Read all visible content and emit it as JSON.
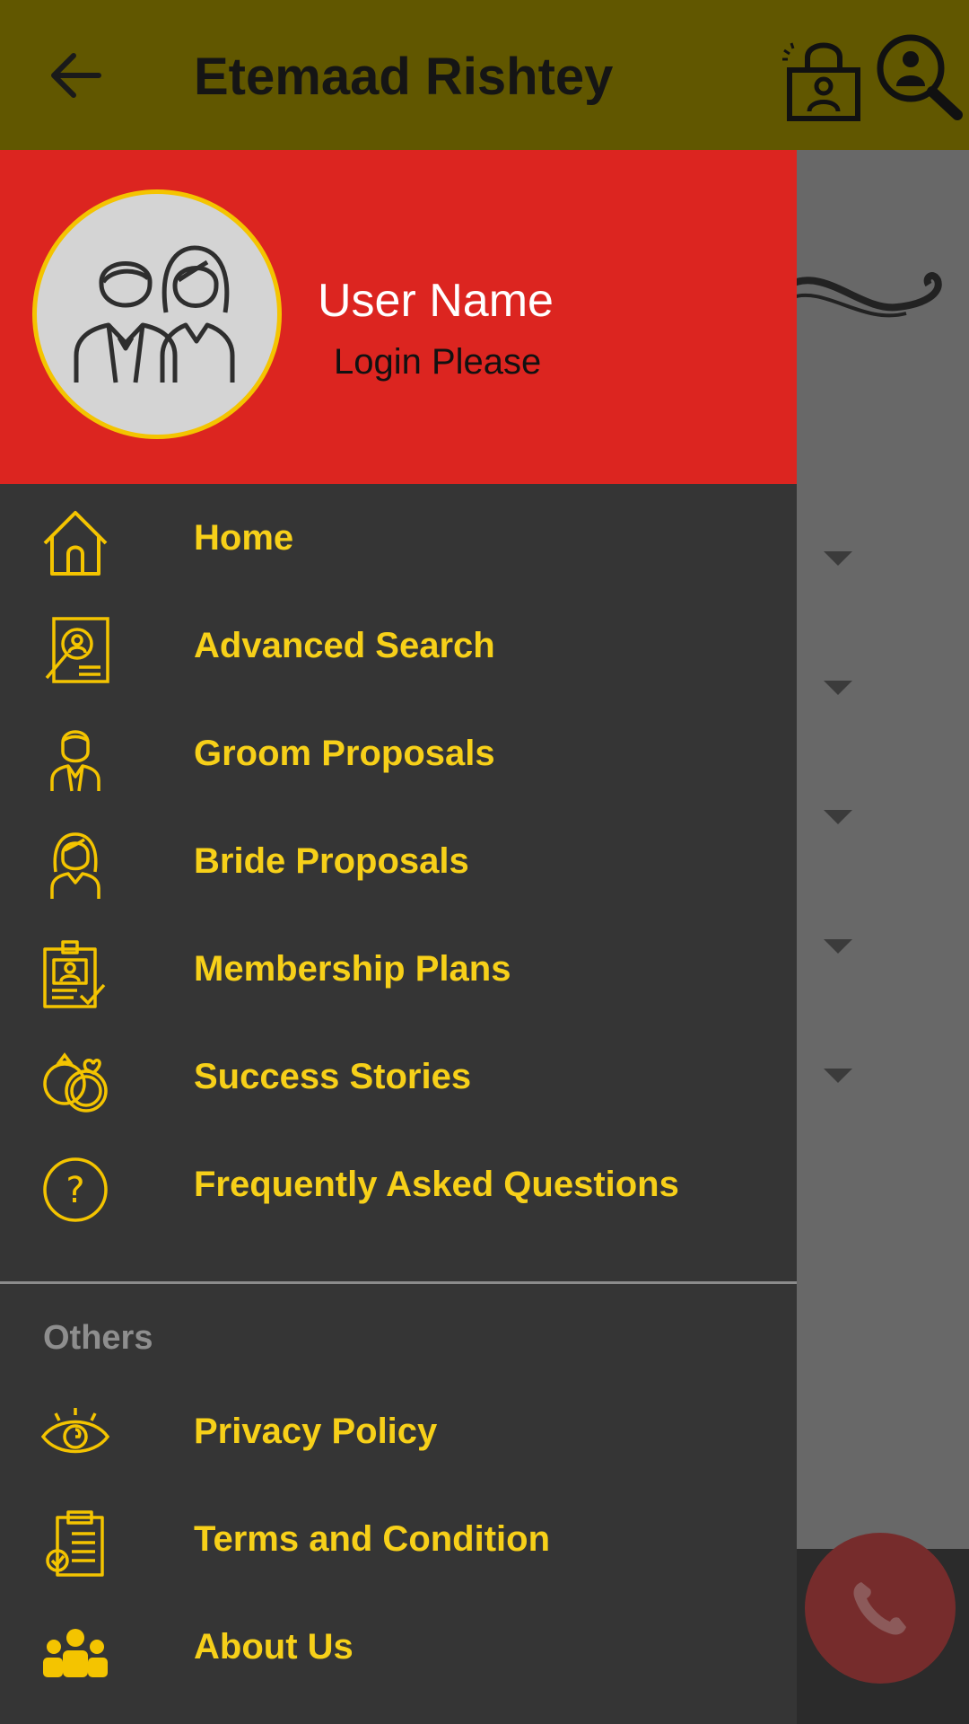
{
  "toolbar": {
    "title": "Etemaad Rishtey",
    "back_icon": "arrow-left-icon",
    "lock_icon": "lock-user-icon",
    "search_icon": "user-search-icon"
  },
  "drawer": {
    "header": {
      "user_name": "User Name",
      "subtitle": "Login Please",
      "avatar_icon": "couple-avatar-icon"
    },
    "items": [
      {
        "label": "Home",
        "icon": "home-icon"
      },
      {
        "label": "Advanced Search",
        "icon": "profile-search-icon"
      },
      {
        "label": "Groom Proposals",
        "icon": "groom-icon"
      },
      {
        "label": "Bride Proposals",
        "icon": "bride-icon"
      },
      {
        "label": "Membership Plans",
        "icon": "membership-card-icon"
      },
      {
        "label": "Success Stories",
        "icon": "rings-icon"
      },
      {
        "label": "Frequently Asked Questions",
        "icon": "question-circle-icon"
      }
    ],
    "others_label": "Others",
    "others": [
      {
        "label": "Privacy Policy",
        "icon": "eye-icon"
      },
      {
        "label": "Terms and Condition",
        "icon": "clipboard-check-icon"
      },
      {
        "label": "About Us",
        "icon": "team-icon"
      }
    ]
  },
  "fab": {
    "icon": "phone-icon"
  },
  "colors": {
    "toolbar_bg": "#615700",
    "drawer_header_bg": "#dc2520",
    "drawer_bg": "#353535",
    "menu_text": "#f7d019",
    "avatar_border": "#f4c400"
  }
}
